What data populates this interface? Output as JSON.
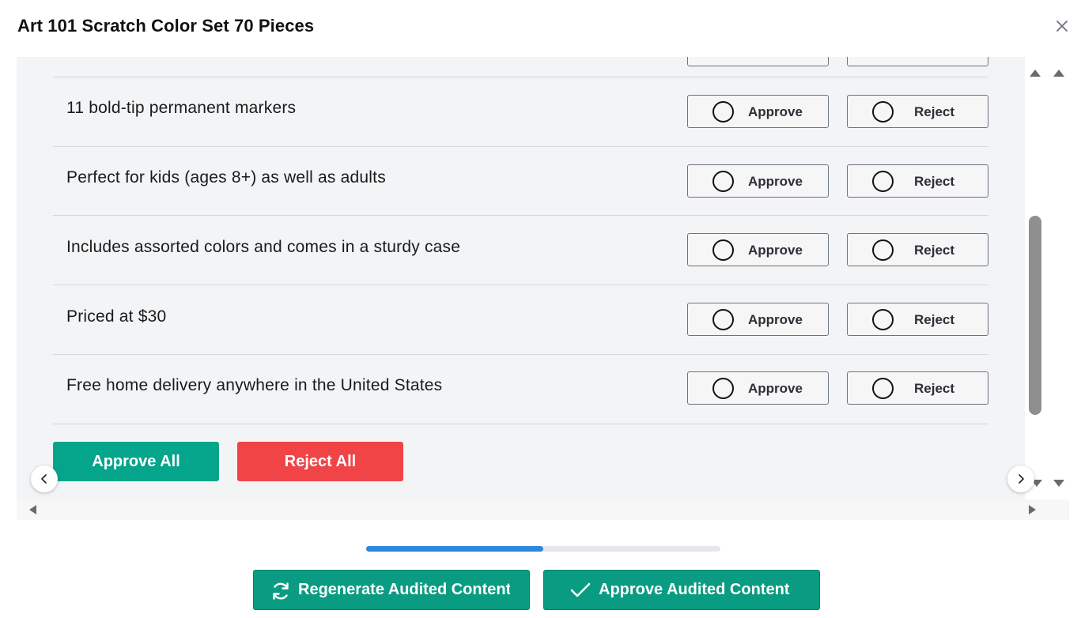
{
  "dialog": {
    "title": "Art 101 Scratch Color Set 70 Pieces",
    "close_icon": "close-icon"
  },
  "items": [
    {
      "text": "11 bold-tip permanent markers",
      "approve_label": "Approve",
      "reject_label": "Reject"
    },
    {
      "text": "Perfect for kids (ages 8+) as well as adults",
      "approve_label": "Approve",
      "reject_label": "Reject"
    },
    {
      "text": "Includes assorted colors and comes in a sturdy case",
      "approve_label": "Approve",
      "reject_label": "Reject"
    },
    {
      "text": "Priced at $30",
      "approve_label": "Approve",
      "reject_label": "Reject"
    },
    {
      "text": "Free home delivery anywhere in the United States",
      "approve_label": "Approve",
      "reject_label": "Reject"
    }
  ],
  "bulk": {
    "approve_all_label": "Approve All",
    "reject_all_label": "Reject All"
  },
  "progress": {
    "fraction": 0.5
  },
  "footer": {
    "regenerate_label": "Regenerate Audited Content",
    "regenerate_icon": "refresh-icon",
    "approve_label": "Approve Audited Content",
    "approve_icon": "check-icon"
  },
  "colors": {
    "accent_green": "#0a9c82",
    "approve_all_green": "#04a58b",
    "reject_red": "#f04447",
    "progress_blue": "#2f86dd",
    "panel_bg": "#f3f4f6"
  }
}
